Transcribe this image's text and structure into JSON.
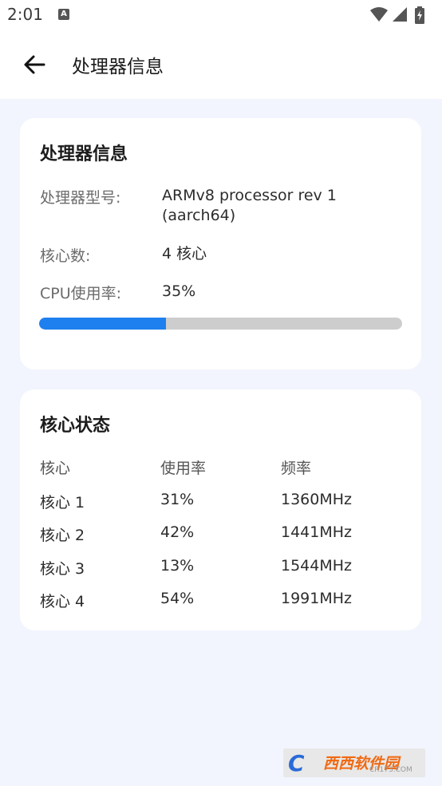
{
  "status_bar": {
    "time": "2:01",
    "notification_glyph": "A",
    "icons": [
      "wifi-icon",
      "signal-icon",
      "battery-charging-icon"
    ]
  },
  "app_bar": {
    "title": "处理器信息",
    "back_icon": "arrow-left-icon"
  },
  "processor_card": {
    "title": "处理器信息",
    "model_label": "处理器型号:",
    "model_value_line1": "ARMv8 processor rev 1",
    "model_value_line2": "(aarch64)",
    "cores_label": "核心数:",
    "cores_value": "4 核心",
    "cpu_usage_label": "CPU使用率:",
    "cpu_usage_value": "35%",
    "cpu_usage_fraction": 0.35,
    "progress_color": "#1e80ee",
    "progress_track_color": "#cdcdcd"
  },
  "core_status_card": {
    "title": "核心状态",
    "headers": [
      "核心",
      "使用率",
      "频率"
    ],
    "rows": [
      [
        "核心 1",
        "31%",
        "1360MHz"
      ],
      [
        "核心 2",
        "42%",
        "1441MHz"
      ],
      [
        "核心 3",
        "13%",
        "1544MHz"
      ],
      [
        "核心 4",
        "54%",
        "1991MHz"
      ]
    ]
  },
  "watermark": {
    "logo_letter": "C",
    "brand": "西西软件园",
    "url": "CR173.COM"
  },
  "colors": {
    "background": "#f2f5fd",
    "card": "#ffffff",
    "accent": "#1e80ee"
  }
}
